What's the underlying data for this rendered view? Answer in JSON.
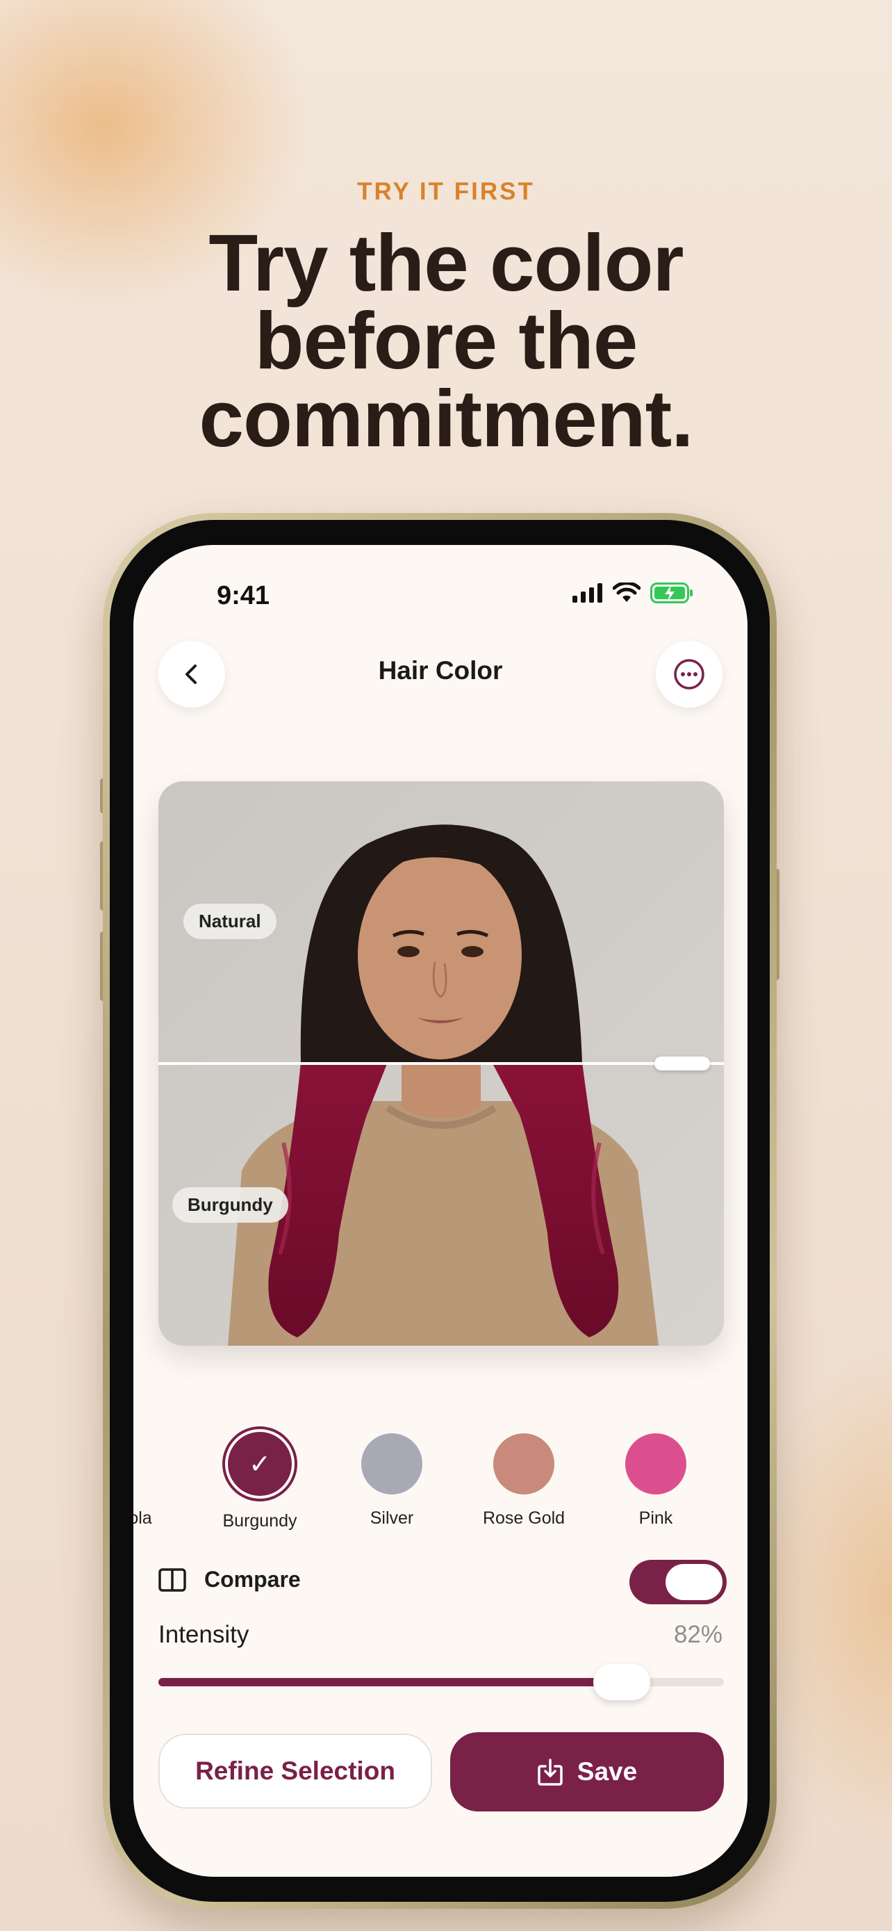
{
  "hero": {
    "eyebrow": "TRY IT FIRST",
    "headline_lines": [
      "Try the color",
      "before the",
      "commitment."
    ]
  },
  "status_bar": {
    "time": "9:41"
  },
  "nav": {
    "title": "Hair Color",
    "back_icon": "chevron-left-icon",
    "more_icon": "more-horizontal-icon"
  },
  "preview": {
    "top_tag": "Natural",
    "bottom_tag": "Burgundy"
  },
  "swatches": [
    {
      "label": "ola",
      "color": "#7a2148"
    },
    {
      "label": "Burgundy",
      "color": "#7a2148",
      "selected": true
    },
    {
      "label": "Silver",
      "color": "#a7aab3"
    },
    {
      "label": "Rose Gold",
      "color": "#c98a7b"
    },
    {
      "label": "Pink",
      "color": "#dc4f8f"
    }
  ],
  "compare": {
    "label": "Compare",
    "enabled": true
  },
  "intensity": {
    "label": "Intensity",
    "value_text": "82%",
    "value": 0.82
  },
  "actions": {
    "refine_label": "Refine Selection",
    "save_label": "Save"
  },
  "colors": {
    "accent": "#7a2148",
    "eyebrow": "#d9822b",
    "heading": "#2a1d18"
  }
}
